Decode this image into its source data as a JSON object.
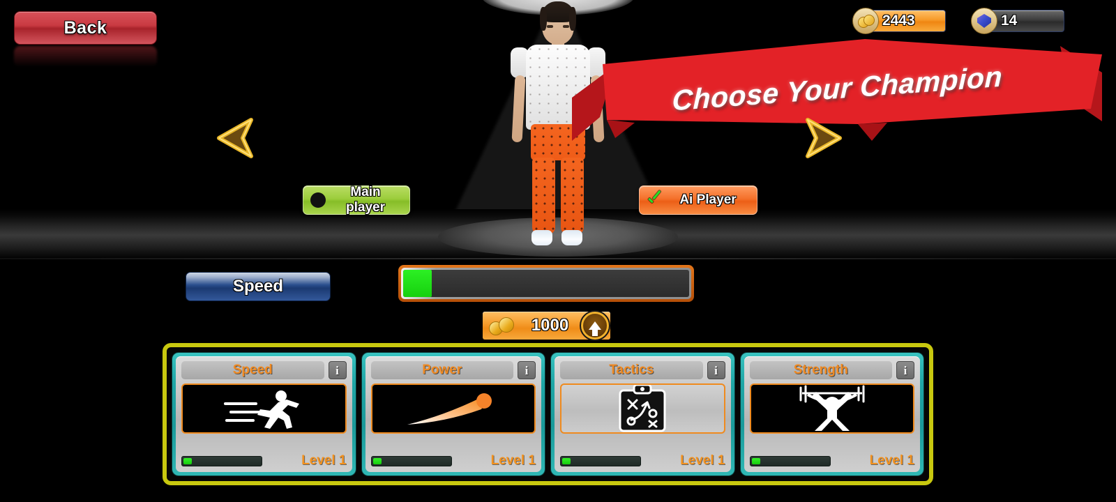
{
  "header": {
    "back_label": "Back",
    "currencies": [
      {
        "id": "coins",
        "icon": "coin-icon",
        "value": "2443"
      },
      {
        "id": "gems",
        "icon": "gem-icon",
        "value": "14"
      }
    ]
  },
  "banner": {
    "text": "Choose Your Champion",
    "color": "#e32227"
  },
  "nav": {
    "left_icon": "arrow-left-icon",
    "right_icon": "arrow-right-icon"
  },
  "player_toggles": [
    {
      "id": "main",
      "label": "Main player",
      "selected": false,
      "marker": "circle-empty-icon",
      "color": "#9ccd3c"
    },
    {
      "id": "ai",
      "label": "Ai Player",
      "selected": true,
      "marker": "check-icon",
      "color": "#f4712b"
    }
  ],
  "stat": {
    "label": "Speed",
    "progress_percent": 10,
    "fill_color": "#22e01a",
    "border_color": "#e2751a"
  },
  "upgrade": {
    "cost": "1000",
    "coin_icon": "coins-icon",
    "action_icon": "up-arrow-icon"
  },
  "cards_frame_color": "#c8c80f",
  "cards": [
    {
      "id": "speed",
      "title": "Speed",
      "icon": "runner-icon",
      "icon_bg": "dark",
      "level": "Level 1",
      "progress_percent": 11
    },
    {
      "id": "power",
      "title": "Power",
      "icon": "comet-icon",
      "icon_bg": "dark",
      "level": "Level 1",
      "progress_percent": 11
    },
    {
      "id": "tactics",
      "title": "Tactics",
      "icon": "clipboard-play-icon",
      "icon_bg": "light",
      "level": "Level 1",
      "progress_percent": 11
    },
    {
      "id": "strength",
      "title": "Strength",
      "icon": "weightlifter-icon",
      "icon_bg": "dark",
      "level": "Level 1",
      "progress_percent": 11
    }
  ],
  "character": {
    "shirt_color": "#ededed",
    "pants_color": "#f0601a",
    "hair_color": "#241a14"
  }
}
